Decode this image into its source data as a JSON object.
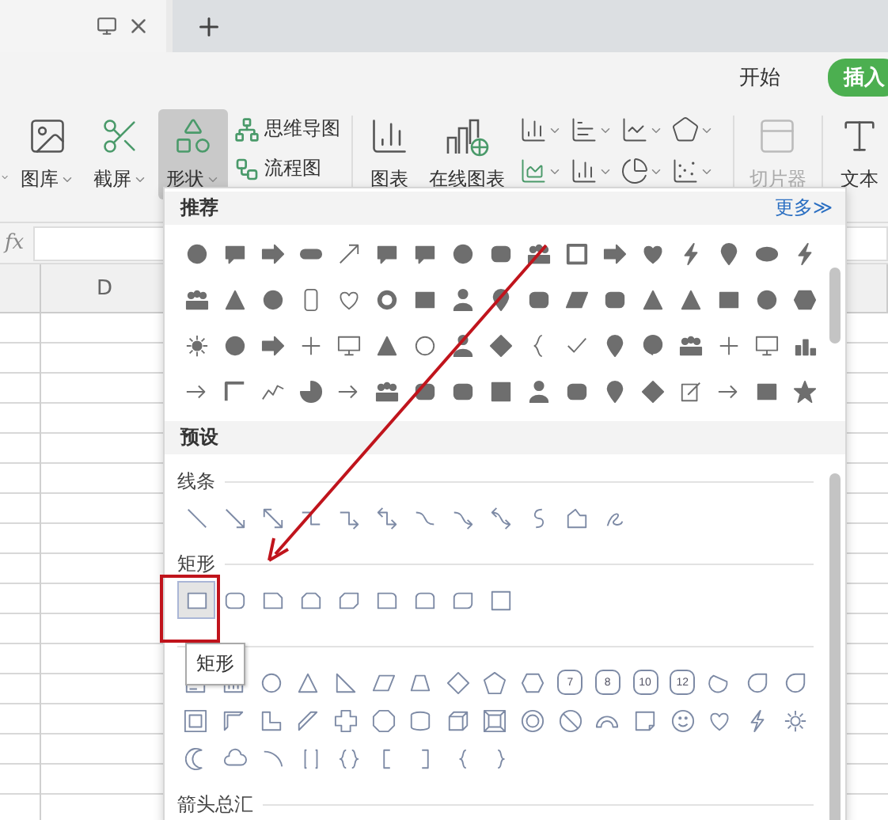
{
  "ribbon_tabs": [
    {
      "label": "开始",
      "selected": false
    },
    {
      "label": "插入",
      "selected": true
    }
  ],
  "toolbar": {
    "insert_buttons": [
      {
        "label": "图库",
        "selected": false
      },
      {
        "label": "截屏",
        "selected": false
      },
      {
        "label": "形状",
        "selected": true
      }
    ],
    "diagram_links": [
      "思维导图",
      "流程图"
    ],
    "chart_buttons": [
      {
        "label": "图表"
      },
      {
        "label": "在线图表"
      }
    ],
    "slicer": {
      "label": "切片器",
      "disabled": true
    },
    "text_button": {
      "label": "文本"
    }
  },
  "formula_bar": {
    "label": "fx"
  },
  "sheet": {
    "columns": [
      "D"
    ]
  },
  "shape_panel": {
    "recommended": {
      "title": "推荐",
      "more_link": "更多≫"
    },
    "preset": {
      "title": "预设",
      "sections": [
        {
          "label": "线条"
        },
        {
          "label": "矩形",
          "items": [
            {
              "selected": true
            },
            {
              "selected": false
            },
            {
              "selected": false
            },
            {
              "selected": false
            },
            {
              "selected": false
            },
            {
              "selected": false
            },
            {
              "selected": false
            },
            {
              "selected": false
            },
            {
              "selected": false
            }
          ]
        },
        {
          "polygon_numbers": [
            "7",
            "8",
            "10",
            "12"
          ]
        },
        {
          "label": "箭头总汇"
        }
      ]
    }
  },
  "tooltip": {
    "text": "矩形"
  }
}
